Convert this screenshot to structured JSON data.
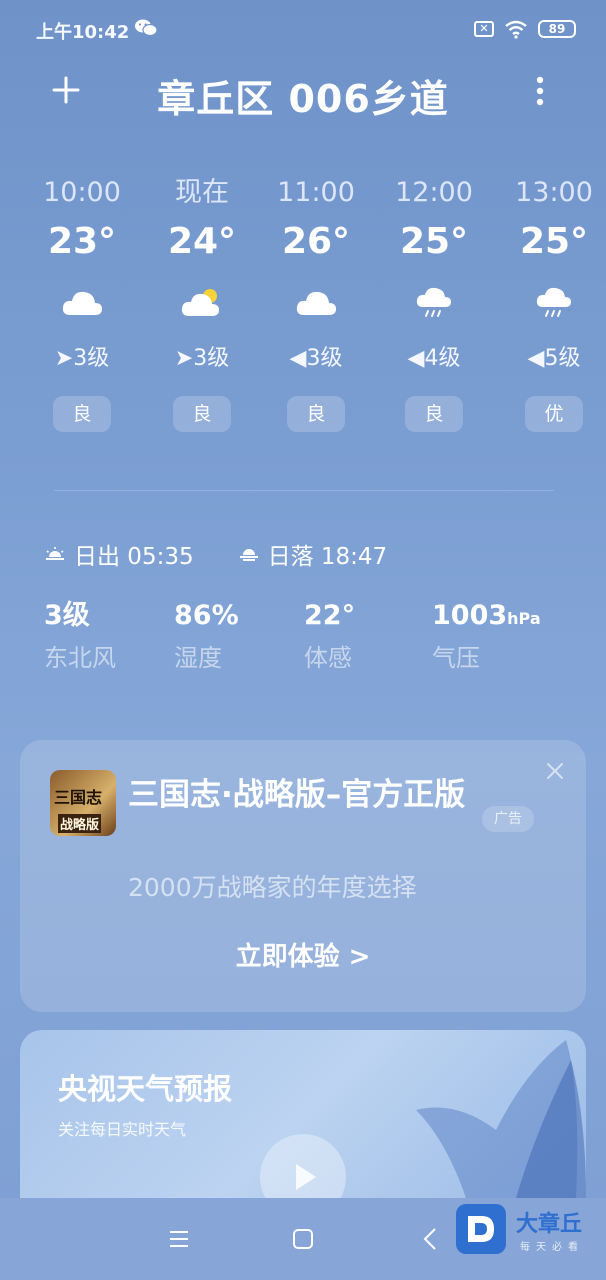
{
  "status_bar": {
    "time": "上午10:42",
    "battery": "89",
    "sim_icon": "x-sim-icon",
    "wifi_icon": "wifi-icon",
    "wechat_icon": "wechat-icon"
  },
  "header": {
    "title": "章丘区 006乡道",
    "add_icon": "plus-icon",
    "more_icon": "more-vertical-icon"
  },
  "hourly": [
    {
      "time": "10:00",
      "temp": "23°",
      "icon": "cloudy",
      "wind": "3级",
      "wind_dir": "sw",
      "aqi": "良"
    },
    {
      "time": "现在",
      "temp": "24°",
      "icon": "partly-sunny",
      "wind": "3级",
      "wind_dir": "sw",
      "aqi": "良"
    },
    {
      "time": "11:00",
      "temp": "26°",
      "icon": "cloudy",
      "wind": "3级",
      "wind_dir": "w",
      "aqi": "良"
    },
    {
      "time": "12:00",
      "temp": "25°",
      "icon": "rain",
      "wind": "4级",
      "wind_dir": "w",
      "aqi": "良"
    },
    {
      "time": "13:00",
      "temp": "25°",
      "icon": "rain",
      "wind": "5级",
      "wind_dir": "w",
      "aqi": "优"
    }
  ],
  "sun": {
    "sunrise": "日出 05:35",
    "sunset": "日落 18:47"
  },
  "stats": [
    {
      "value": "3级",
      "unit": "",
      "label": "东北风"
    },
    {
      "value": "86%",
      "unit": "",
      "label": "湿度"
    },
    {
      "value": "22°",
      "unit": "",
      "label": "体感"
    },
    {
      "value": "1003",
      "unit": "hPa",
      "label": "气压"
    }
  ],
  "ad": {
    "title": "三国志·战略版–官方正版",
    "badge": "广告",
    "description": "2000万战略家的年度选择",
    "cta": "立即体验 >",
    "logo_text_top": "三国志",
    "logo_text_bottom": "战略版"
  },
  "cctv": {
    "title": "央视天气预报",
    "subtitle": "关注每日实时天气"
  },
  "watermark": {
    "title": "大章丘",
    "subtitle": "每天必看"
  },
  "colors": {
    "background_top": "#6f93c9",
    "background_bottom": "#86a7d8",
    "sun_yellow": "#f6d13a",
    "watermark_blue": "#2f6fd0"
  }
}
